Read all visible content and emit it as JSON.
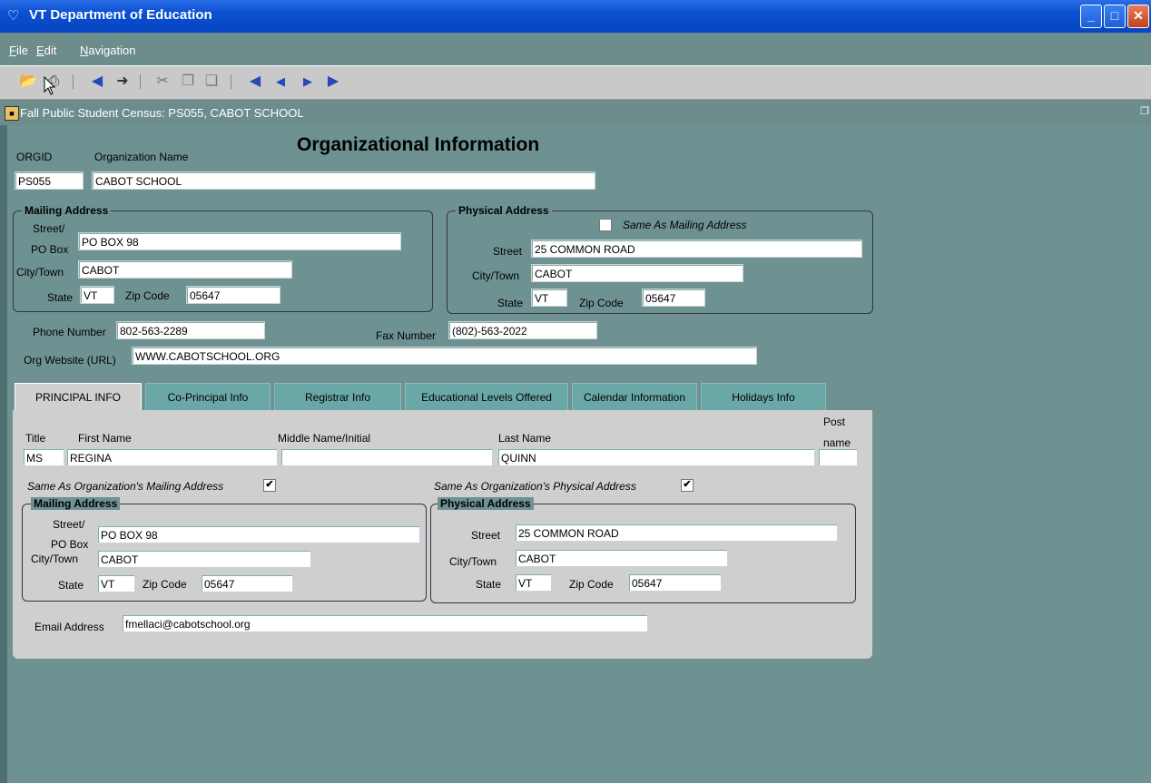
{
  "window": {
    "title": "VT Department of Education",
    "icon": "app-icon"
  },
  "menu": [
    {
      "label": "File",
      "accel": "F",
      "rest": "ile"
    },
    {
      "label": "Edit",
      "accel": "E",
      "rest": "dit"
    },
    {
      "label": "Navigation",
      "accel": "N",
      "rest": "avigation"
    }
  ],
  "toolbar": [
    "open-folder-icon",
    "print-icon",
    "first-record-icon",
    "exit-icon",
    "cut-icon",
    "copy-icon",
    "paste-icon",
    "rewind-icon",
    "previous-icon",
    "next-icon",
    "last-icon"
  ],
  "form": {
    "title": "Fall Public Student Census: PS055, CABOT SCHOOL"
  },
  "org": {
    "heading": "Organizational Information",
    "orgid_label": "ORGID",
    "name_label": "Organization Name",
    "orgid": "PS055",
    "name": "CABOT SCHOOL"
  },
  "mailing": {
    "title": "Mailing Address",
    "street_label_1": "Street/",
    "street_label_2": "PO Box",
    "street": "PO BOX 98",
    "city_label": "City/Town",
    "city": "CABOT",
    "state_label": "State",
    "state": "VT",
    "zip_label": "Zip Code",
    "zip": "05647"
  },
  "physical": {
    "title": "Physical Address",
    "same_label": "Same As Mailing Address",
    "same_checked": false,
    "street_label": "Street",
    "street": "25 COMMON ROAD",
    "city_label": "City/Town",
    "city": "CABOT",
    "state_label": "State",
    "state": "VT",
    "zip_label": "Zip Code",
    "zip": "05647"
  },
  "contact": {
    "phone_label": "Phone Number",
    "phone": "802-563-2289",
    "fax_label": "Fax Number",
    "fax": "(802)-563-2022",
    "url_label": "Org Website (URL)",
    "url": "WWW.CABOTSCHOOL.ORG"
  },
  "tabs": [
    "PRINCIPAL INFO",
    "Co-Principal Info",
    "Registrar Info",
    "Educational Levels Offered",
    "Calendar Information",
    "Holidays Info"
  ],
  "principal": {
    "title_label": "Title",
    "first_label": "First Name",
    "middle_label": "Middle Name/Initial",
    "last_label": "Last Name",
    "post_label_1": "Post",
    "post_label_2": "name",
    "title": "MS",
    "first": "REGINA",
    "middle": "",
    "last": "QUINN",
    "post": "",
    "same_mail_label": "Same As Organization's Mailing Address",
    "same_phys_label": "Same As Organization's Physical Address",
    "check_mark": "✔",
    "mailing": {
      "title": "Mailing Address",
      "street_label_1": "Street/",
      "street_label_2": "PO Box",
      "street": "PO BOX 98",
      "city_label": "City/Town",
      "city": "CABOT",
      "state_label": "State",
      "state": "VT",
      "zip_label": "Zip Code",
      "zip": "05647"
    },
    "physical": {
      "title": "Physical Address",
      "street_label": "Street",
      "street": "25 COMMON ROAD",
      "city_label": "City/Town",
      "city": "CABOT",
      "state_label": "State",
      "state": "VT",
      "zip_label": "Zip Code",
      "zip": "05647"
    },
    "email_label": "Email Address",
    "email": "fmellaci@cabotschool.org"
  }
}
